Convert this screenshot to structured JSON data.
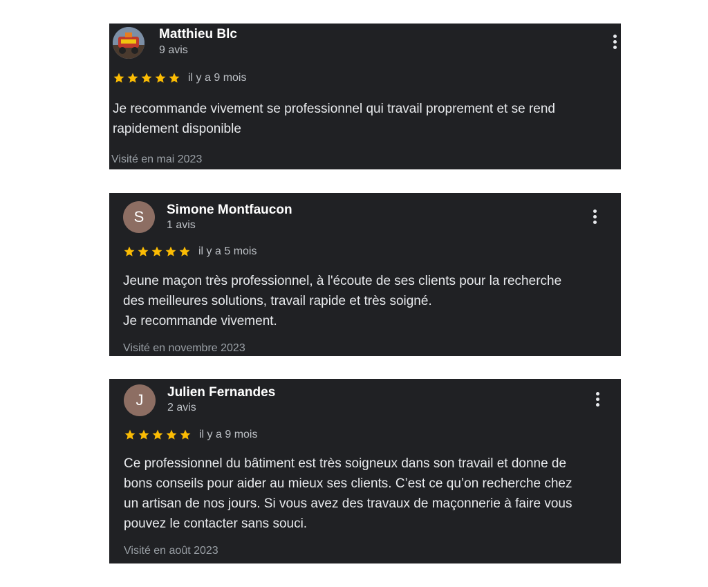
{
  "reviews": [
    {
      "name": "Matthieu Blc",
      "count": "9 avis",
      "avatar_type": "photo",
      "rating": 5,
      "time_ago": "il y a 9 mois",
      "text": "Je recommande vivement se professionnel qui travail proprement et se rend\nrapidement disponible",
      "visited": "Visité en mai 2023"
    },
    {
      "name": "Simone Montfaucon",
      "count": "1 avis",
      "avatar_type": "letter",
      "avatar_letter": "S",
      "rating": 5,
      "time_ago": "il y a 5 mois",
      "text": "Jeune maçon très professionnel, à l'écoute de ses clients pour la recherche\ndes meilleures solutions, travail rapide et très soigné.\nJe recommande vivement.",
      "visited": "Visité en novembre 2023"
    },
    {
      "name": "Julien Fernandes",
      "count": "2 avis",
      "avatar_type": "letter",
      "avatar_letter": "J",
      "rating": 5,
      "time_ago": "il y a 9 mois",
      "text": "Ce professionnel du bâtiment est très soigneux dans son travail et donne de\nbons conseils pour aider au mieux ses clients. C’est ce qu’on recherche chez\nun artisan de nos jours. Si vous avez des travaux de maçonnerie à faire vous\npouvez le contacter sans souci.",
      "visited": "Visité en août 2023"
    }
  ],
  "colors": {
    "card_background": "#202124",
    "star": "#fbbc04",
    "avatar_letter_bg": "#8d6e63"
  }
}
